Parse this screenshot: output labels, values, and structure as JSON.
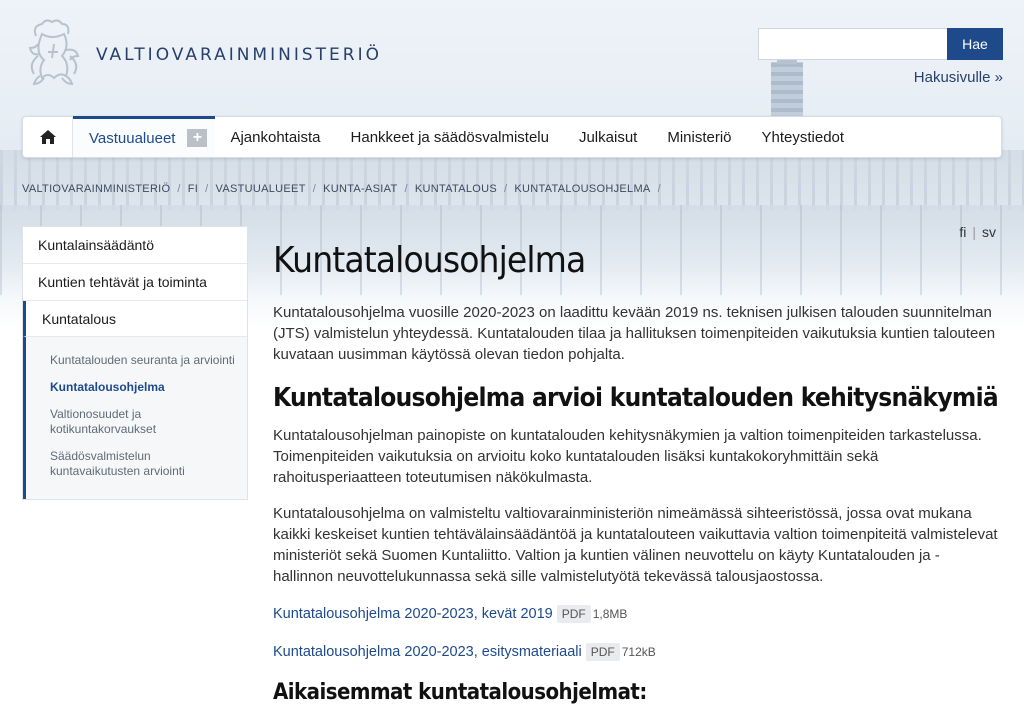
{
  "header": {
    "brand": "VALTIOVARAINMINISTERIÖ",
    "search_placeholder": "",
    "search_button": "Hae",
    "search_page_link": "Hakusivulle »"
  },
  "nav": {
    "items": [
      {
        "label": "Vastuualueet",
        "active": true
      },
      {
        "label": "Ajankohtaista"
      },
      {
        "label": "Hankkeet ja säädösvalmistelu"
      },
      {
        "label": "Julkaisut"
      },
      {
        "label": "Ministeriö"
      },
      {
        "label": "Yhteystiedot"
      }
    ],
    "expand_symbol": "+"
  },
  "breadcrumb": [
    "Valtiovarainministeriö",
    "FI",
    "Vastuualueet",
    "Kunta-asiat",
    "Kuntatalous",
    "Kuntatalousohjelma"
  ],
  "lang": {
    "fi": "fi",
    "sv": "sv"
  },
  "sidebar": {
    "items": [
      "Kuntalainsäädäntö",
      "Kuntien tehtävät ja toiminta",
      "Kuntatalous"
    ],
    "sub_items": [
      "Kuntatalouden seuranta ja arviointi",
      "Kuntatalousohjelma",
      "Valtionosuudet ja kotikuntakorvaukset",
      "Säädösvalmistelun kuntavaikutusten arviointi"
    ]
  },
  "content": {
    "title": "Kuntatalousohjelma",
    "intro": "Kuntatalousohjelma vuosille 2020-2023 on laadittu kevään 2019 ns. teknisen julkisen talouden suunnitelman (JTS) valmistelun yhteydessä. Kuntatalouden tilaa ja hallituksen toimenpiteiden vaikutuksia kuntien talouteen kuvataan uusimman käytössä olevan tiedon pohjalta.",
    "h2": "Kuntatalousohjelma arvioi kuntatalouden kehitysnäkymiä",
    "p2": "Kuntatalousohjelman painopiste on kuntatalouden kehitysnäkymien ja valtion toimenpiteiden tarkastelussa. Toimenpiteiden vaikutuksia on arvioitu koko kuntatalouden lisäksi kuntakokoryhmittäin sekä rahoitusperiaatteen toteutumisen näkökulmasta.",
    "p3": "Kuntatalousohjelma on valmisteltu valtiovarainministeriön nimeämässä sihteeristössä, jossa ovat mukana kaikki keskeiset kuntien tehtävälainsäädäntöä ja kuntatalouteen vaikuttavia valtion toimenpiteitä valmistelevat ministeriöt sekä Suomen Kuntaliitto. Valtion ja kuntien välinen neuvottelu on käyty Kuntatalouden ja -hallinnon neuvottelukunnassa sekä sille valmistelutyötä tekevässä talousjaostossa.",
    "downloads": [
      {
        "label": "Kuntatalousohjelma 2020-2023, kevät 2019",
        "type": "PDF",
        "size": "1,8MB"
      },
      {
        "label": "Kuntatalousohjelma 2020-2023, esitysmateriaali",
        "type": "PDF",
        "size": "712kB"
      }
    ],
    "h3": "Aikaisemmat kuntatalousohjelmat:"
  }
}
